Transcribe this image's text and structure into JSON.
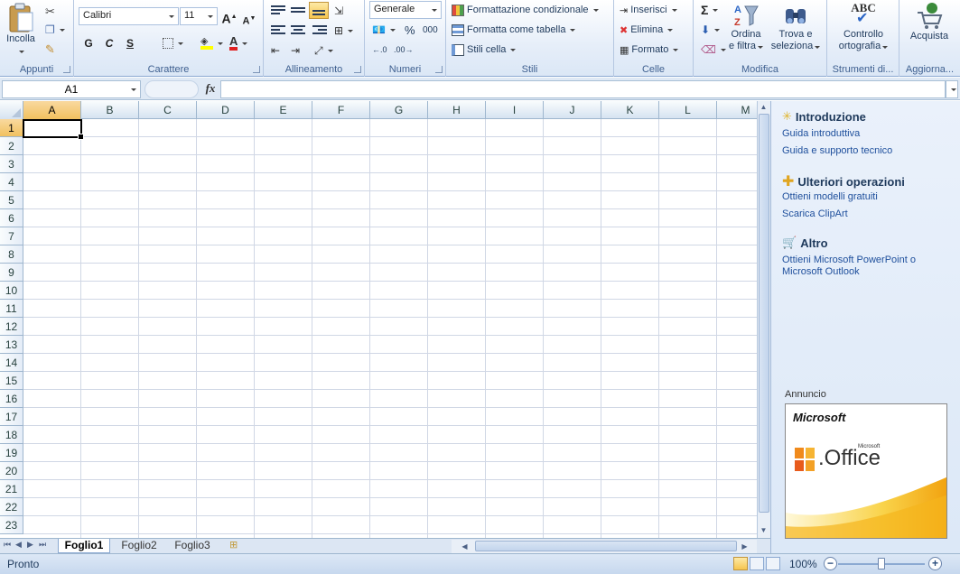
{
  "ribbon": {
    "groups": {
      "appunti": {
        "label": "Appunti",
        "paste_label": "Incolla"
      },
      "carattere": {
        "label": "Carattere",
        "font_name": "Calibri",
        "font_size": "11",
        "bold": "G",
        "italic": "C",
        "underline": "S"
      },
      "allineamento": {
        "label": "Allineamento"
      },
      "numeri": {
        "label": "Numeri",
        "format": "Generale",
        "percent": "%",
        "thousands": "000"
      },
      "stili": {
        "label": "Stili",
        "conditional": "Formattazione condizionale",
        "as_table": "Formatta come tabella",
        "cell_styles": "Stili cella"
      },
      "celle": {
        "label": "Celle",
        "insert": "Inserisci",
        "delete": "Elimina",
        "format": "Formato"
      },
      "modifica": {
        "label": "Modifica",
        "sort_line1": "Ordina",
        "sort_line2": "e filtra",
        "find_line1": "Trova e",
        "find_line2": "seleziona"
      },
      "strumenti": {
        "label": "Strumenti di...",
        "spell_line1": "Controllo",
        "spell_line2": "ortografia",
        "spell_abc": "ABC"
      },
      "aggiorna": {
        "label": "Aggiorna...",
        "buy": "Acquista"
      }
    }
  },
  "formula_bar": {
    "name_box": "A1",
    "fx": "fx",
    "formula": ""
  },
  "grid": {
    "columns": [
      "A",
      "B",
      "C",
      "D",
      "E",
      "F",
      "G",
      "H",
      "I",
      "J",
      "K",
      "L",
      "M"
    ],
    "rows": [
      "1",
      "2",
      "3",
      "4",
      "5",
      "6",
      "7",
      "8",
      "9",
      "10",
      "11",
      "12",
      "13",
      "14",
      "15",
      "16",
      "17",
      "18",
      "19",
      "20",
      "21",
      "22",
      "23"
    ],
    "active_cell": "A1"
  },
  "sheets": {
    "tabs": [
      "Foglio1",
      "Foglio2",
      "Foglio3"
    ],
    "active": "Foglio1"
  },
  "status": {
    "text": "Pronto",
    "zoom": "100%"
  },
  "task_pane": {
    "sections": [
      {
        "title": "Introduzione",
        "links": [
          "Guida introduttiva",
          "Guida e supporto tecnico"
        ]
      },
      {
        "title": "Ulteriori operazioni",
        "links": [
          "Ottieni modelli gratuiti",
          "Scarica ClipArt"
        ]
      },
      {
        "title": "Altro",
        "links": [
          "Ottieni Microsoft PowerPoint o Microsoft Outlook"
        ]
      }
    ],
    "ad_label": "Annuncio",
    "ad_brand": "Microsoft",
    "ad_product": ".Office",
    "ad_brand_small": "Microsoft"
  }
}
